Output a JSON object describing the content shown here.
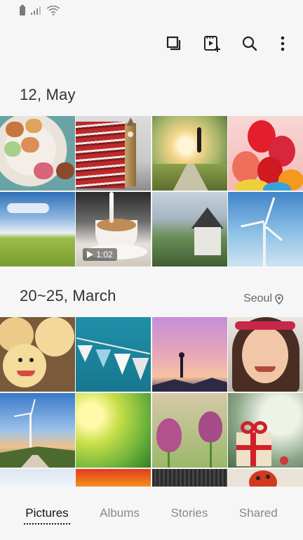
{
  "toolbar": {
    "icons": [
      "select-icon",
      "create-video-icon",
      "search-icon",
      "more-options-icon"
    ]
  },
  "sections": [
    {
      "date": "12, May",
      "location": "",
      "video_duration": "1:02"
    },
    {
      "date": "20~25, March",
      "location": "Seoul"
    }
  ],
  "nav": {
    "tabs": [
      "Pictures",
      "Albums",
      "Stories",
      "Shared"
    ],
    "active": "Pictures"
  },
  "colors": {
    "background": "#f6f6f6",
    "active_tab": "#111111",
    "inactive_tab": "#888888"
  }
}
